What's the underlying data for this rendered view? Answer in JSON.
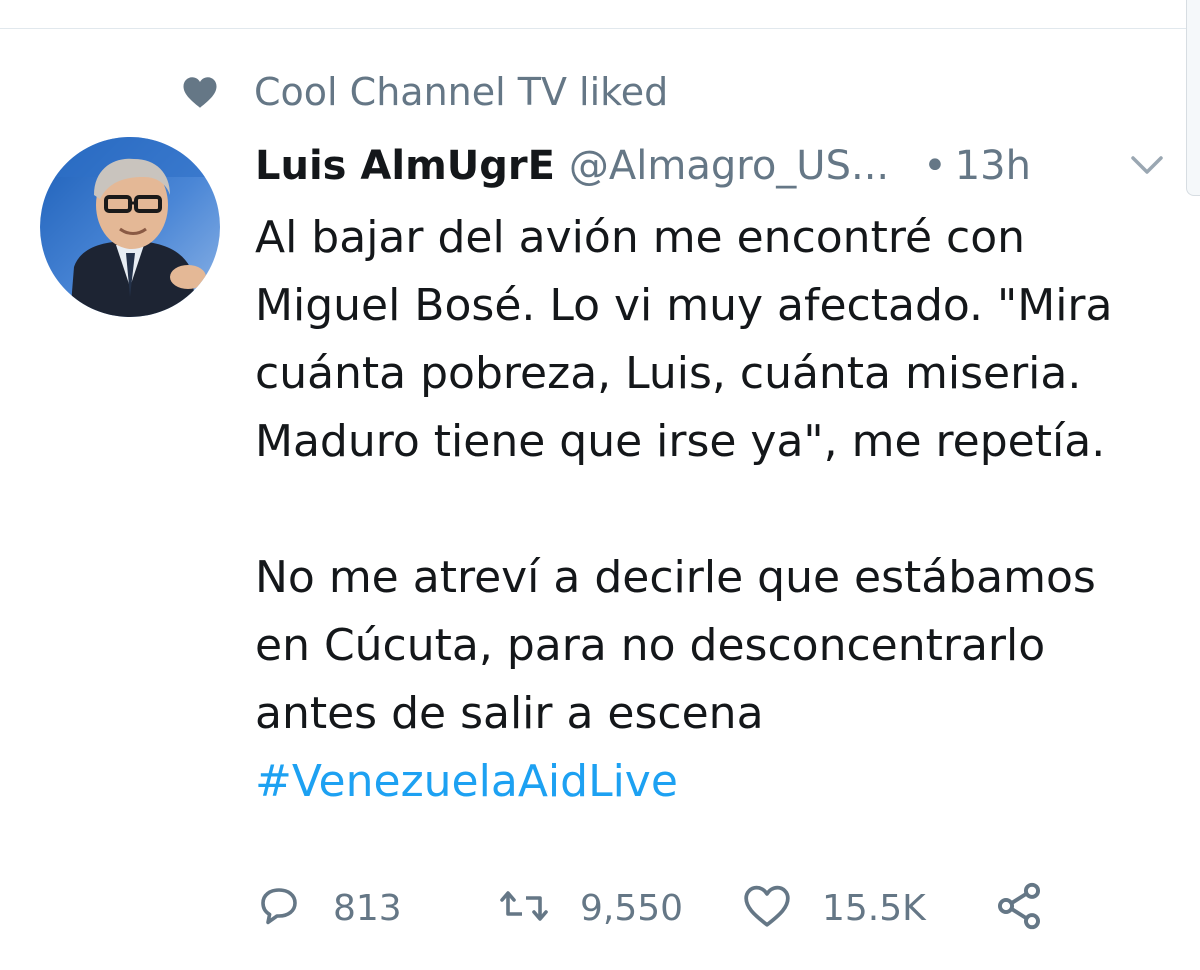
{
  "social_context": {
    "text": "Cool Channel TV liked",
    "icon": "heart-icon"
  },
  "tweet": {
    "author": {
      "display_name": "Luis AlmUgrE",
      "handle": "@Almagro_US...",
      "avatar_icon": "avatar-photo"
    },
    "separator": "•",
    "time": "13h",
    "menu_icon": "chevron-down-icon",
    "text_lines": [
      "Al bajar del avión me encontré con",
      "Miguel Bosé. Lo vi muy afectado. \"Mira",
      "cuánta pobreza, Luis, cuánta miseria.",
      "Maduro tiene que irse ya\", me repetía.",
      "",
      "No me atreví a decirle que estábamos",
      "en Cúcuta, para no desconcentrarlo",
      "antes de salir a escena"
    ],
    "hashtag": "#VenezuelaAidLive",
    "actions": {
      "replies": "813",
      "retweets": "9,550",
      "likes": "15.5K",
      "reply_icon": "reply-icon",
      "retweet_icon": "retweet-icon",
      "like_icon": "heart-outline-icon",
      "share_icon": "share-icon"
    }
  },
  "colors": {
    "text_primary": "#14171a",
    "text_secondary": "#657786",
    "link": "#1da1f2",
    "divider": "#e1e8ed"
  }
}
